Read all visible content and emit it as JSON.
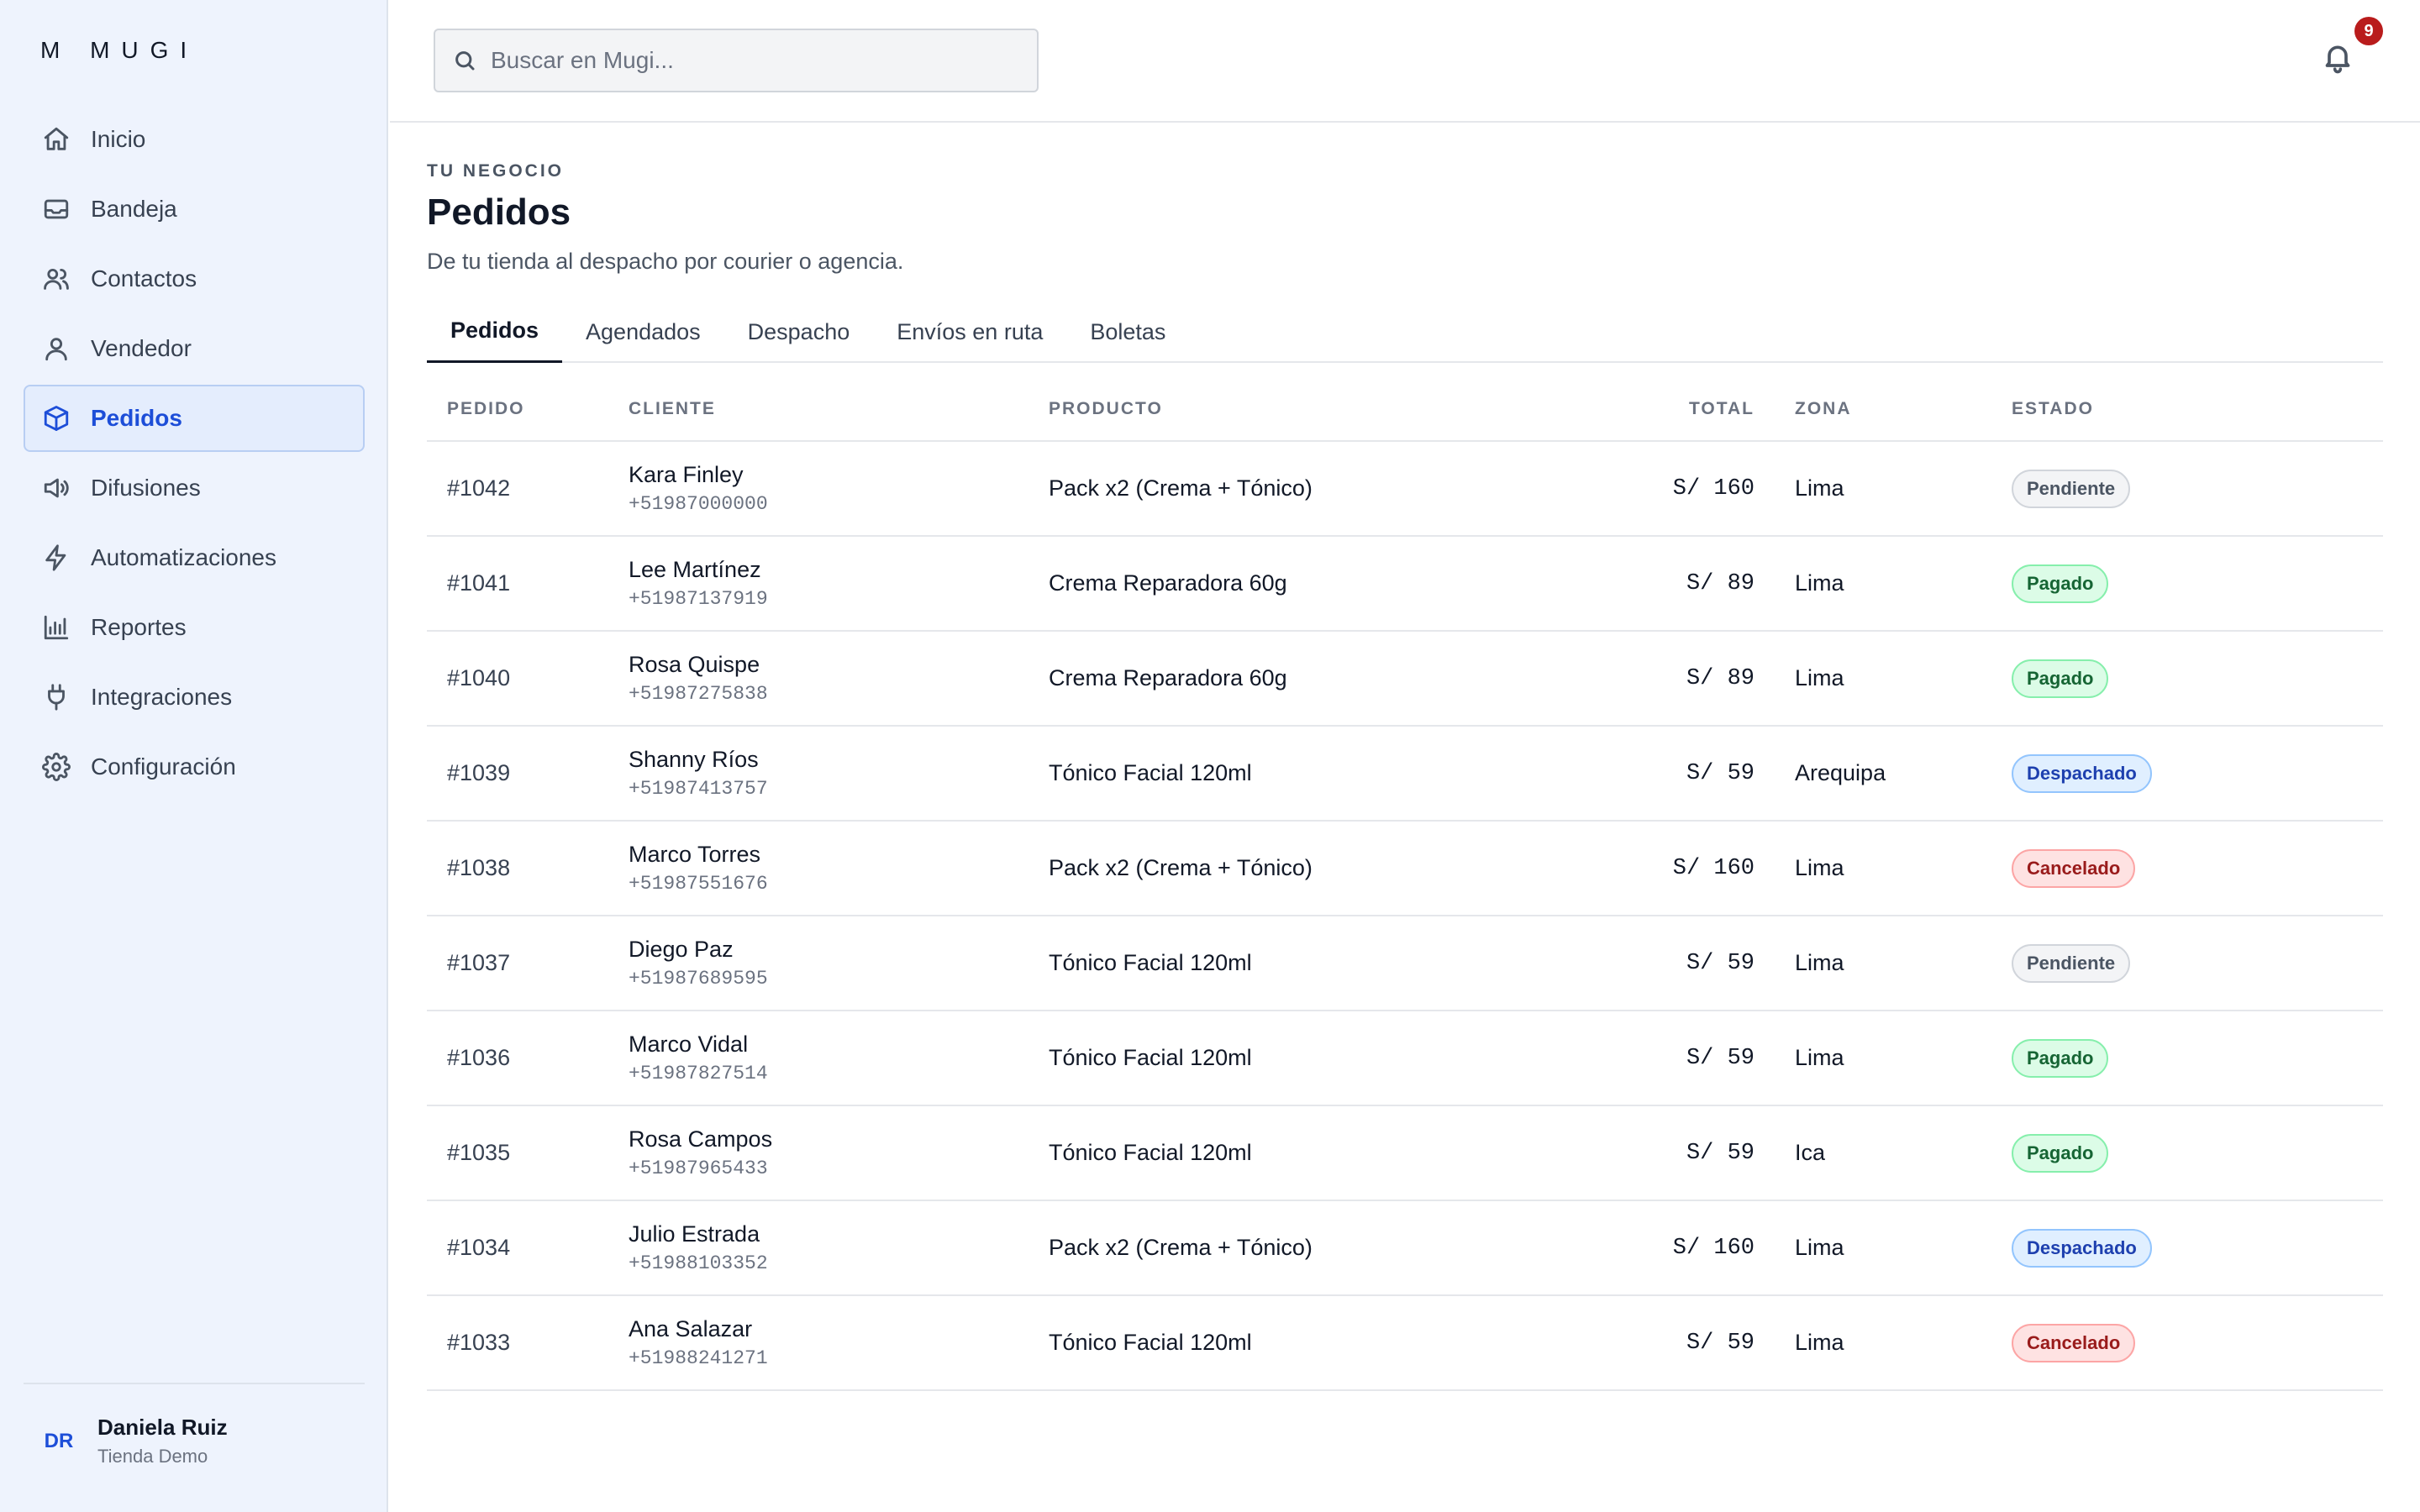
{
  "app": {
    "logo": "M  MUGI"
  },
  "sidebar": {
    "items": [
      {
        "label": "Inicio",
        "icon": "home-icon",
        "active": false
      },
      {
        "label": "Bandeja",
        "icon": "inbox-icon",
        "active": false
      },
      {
        "label": "Contactos",
        "icon": "users-icon",
        "active": false
      },
      {
        "label": "Vendedor",
        "icon": "user-icon",
        "active": false
      },
      {
        "label": "Pedidos",
        "icon": "box-icon",
        "active": true
      },
      {
        "label": "Difusiones",
        "icon": "megaphone-icon",
        "active": false
      },
      {
        "label": "Automatizaciones",
        "icon": "bolt-icon",
        "active": false
      },
      {
        "label": "Reportes",
        "icon": "bar-chart-icon",
        "active": false
      },
      {
        "label": "Integraciones",
        "icon": "plug-icon",
        "active": false
      },
      {
        "label": "Configuración",
        "icon": "gear-icon",
        "active": false
      }
    ],
    "user": {
      "initials": "DR",
      "name": "Daniela Ruiz",
      "store": "Tienda Demo"
    }
  },
  "topbar": {
    "search_placeholder": "Buscar en Mugi...",
    "notifications_count": "9"
  },
  "header": {
    "eyebrow": "TU NEGOCIO",
    "title": "Pedidos",
    "subtitle": "De tu tienda al despacho por courier o agencia."
  },
  "tabs": [
    {
      "label": "Pedidos",
      "active": true
    },
    {
      "label": "Agendados",
      "active": false
    },
    {
      "label": "Despacho",
      "active": false
    },
    {
      "label": "Envíos en ruta",
      "active": false
    },
    {
      "label": "Boletas",
      "active": false
    }
  ],
  "table": {
    "columns": {
      "pedido": "PEDIDO",
      "cliente": "CLIENTE",
      "producto": "PRODUCTO",
      "total": "TOTAL",
      "zona": "ZONA",
      "estado": "ESTADO"
    },
    "rows": [
      {
        "id": "#1042",
        "name": "Kara Finley",
        "phone": "+51987000000",
        "product": "Pack x2 (Crema + Tónico)",
        "total": "S/ 160",
        "zone": "Lima",
        "status": "Pendiente",
        "status_key": "pendiente"
      },
      {
        "id": "#1041",
        "name": "Lee Martínez",
        "phone": "+51987137919",
        "product": "Crema Reparadora 60g",
        "total": "S/ 89",
        "zone": "Lima",
        "status": "Pagado",
        "status_key": "pagado"
      },
      {
        "id": "#1040",
        "name": "Rosa Quispe",
        "phone": "+51987275838",
        "product": "Crema Reparadora 60g",
        "total": "S/ 89",
        "zone": "Lima",
        "status": "Pagado",
        "status_key": "pagado"
      },
      {
        "id": "#1039",
        "name": "Shanny Ríos",
        "phone": "+51987413757",
        "product": "Tónico Facial 120ml",
        "total": "S/ 59",
        "zone": "Arequipa",
        "status": "Despachado",
        "status_key": "despachado"
      },
      {
        "id": "#1038",
        "name": "Marco Torres",
        "phone": "+51987551676",
        "product": "Pack x2 (Crema + Tónico)",
        "total": "S/ 160",
        "zone": "Lima",
        "status": "Cancelado",
        "status_key": "cancelado"
      },
      {
        "id": "#1037",
        "name": "Diego Paz",
        "phone": "+51987689595",
        "product": "Tónico Facial 120ml",
        "total": "S/ 59",
        "zone": "Lima",
        "status": "Pendiente",
        "status_key": "pendiente"
      },
      {
        "id": "#1036",
        "name": "Marco Vidal",
        "phone": "+51987827514",
        "product": "Tónico Facial 120ml",
        "total": "S/ 59",
        "zone": "Lima",
        "status": "Pagado",
        "status_key": "pagado"
      },
      {
        "id": "#1035",
        "name": "Rosa Campos",
        "phone": "+51987965433",
        "product": "Tónico Facial 120ml",
        "total": "S/ 59",
        "zone": "Ica",
        "status": "Pagado",
        "status_key": "pagado"
      },
      {
        "id": "#1034",
        "name": "Julio Estrada",
        "phone": "+51988103352",
        "product": "Pack x2 (Crema + Tónico)",
        "total": "S/ 160",
        "zone": "Lima",
        "status": "Despachado",
        "status_key": "despachado"
      },
      {
        "id": "#1033",
        "name": "Ana Salazar",
        "phone": "+51988241271",
        "product": "Tónico Facial 120ml",
        "total": "S/ 59",
        "zone": "Lima",
        "status": "Cancelado",
        "status_key": "cancelado"
      }
    ]
  },
  "colors": {
    "accent": "#1d4ed8",
    "sidebar_bg": "#eef3fd",
    "badge": "#b91c1c"
  }
}
